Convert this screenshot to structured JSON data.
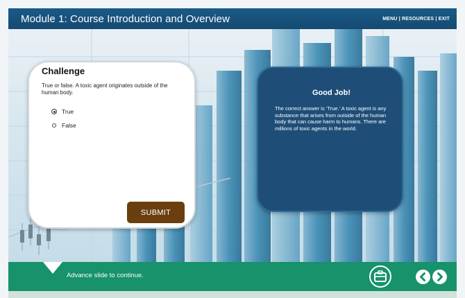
{
  "header": {
    "title": "Module 1: Course Introduction and Overview",
    "menu": "MENU | RESOURCES | EXIT"
  },
  "challenge": {
    "title": "Challenge",
    "question": "True or false. A toxic agent originates outside of the human body.",
    "options": [
      {
        "label": "True",
        "selected": true
      },
      {
        "label": "False",
        "selected": false
      }
    ],
    "submit_label": "SUBMIT"
  },
  "feedback": {
    "title": "Good Job!",
    "text": "The correct answer is ‘True.’ A toxic agent is any substance that arises from outside of the human body that can cause harm to humans. There are millions of toxic agents in the world."
  },
  "footer": {
    "advance_text": "Advance slide to continue."
  },
  "icons": {
    "resources": "briefcase-icon",
    "previous": "chevron-left-icon",
    "next": "chevron-right-icon"
  },
  "colors": {
    "header": "#1a5a87",
    "footer": "#17926a",
    "feedback_card": "#1e4e77",
    "submit": "#6b3e10"
  }
}
